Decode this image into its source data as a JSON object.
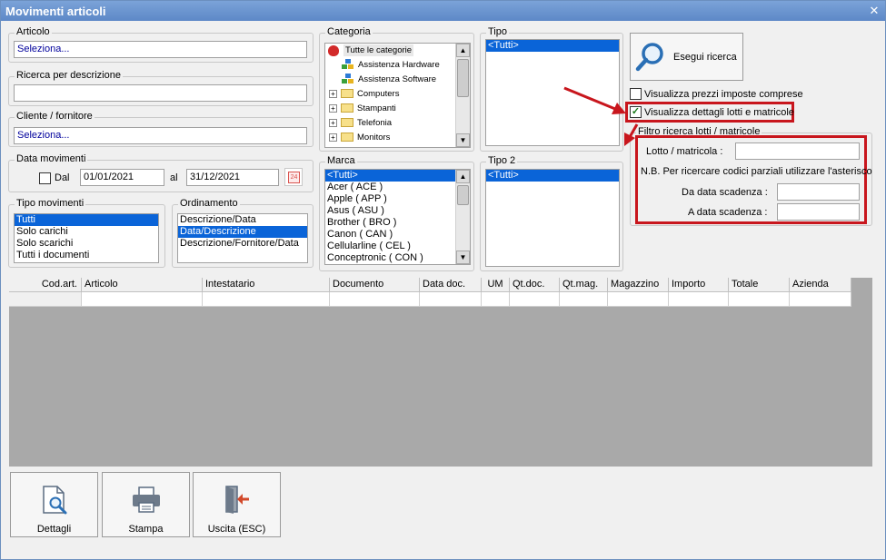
{
  "window": {
    "title": "Movimenti articoli",
    "close_glyph": "✕"
  },
  "articolo": {
    "label": "Articolo",
    "value": "Seleziona..."
  },
  "ricerca": {
    "label": "Ricerca per descrizione",
    "value": ""
  },
  "cliente": {
    "label": "Cliente / fornitore",
    "value": "Seleziona..."
  },
  "data_movimenti": {
    "label": "Data movimenti",
    "dal_label": "Dal",
    "dal_value": "01/01/2021",
    "al_label": "al",
    "al_value": "31/12/2021",
    "calendar_day": "24"
  },
  "tipo_movimenti": {
    "label": "Tipo movimenti",
    "items": [
      "Tutti",
      "Solo carichi",
      "Solo scarichi",
      "Tutti i documenti"
    ],
    "selected": 0
  },
  "ordinamento": {
    "label": "Ordinamento",
    "items": [
      "Descrizione/Data",
      "Data/Descrizione",
      "Descrizione/Fornitore/Data"
    ],
    "selected": 1
  },
  "categoria": {
    "label": "Categoria",
    "root": "Tutte le categorie",
    "children": [
      {
        "label": "Assistenza Hardware",
        "icon": "network-icon",
        "expandable": false
      },
      {
        "label": "Assistenza Software",
        "icon": "network-icon",
        "expandable": false
      },
      {
        "label": "Computers",
        "icon": "folder-icon",
        "expandable": true
      },
      {
        "label": "Stampanti",
        "icon": "folder-icon",
        "expandable": true
      },
      {
        "label": "Telefonia",
        "icon": "folder-icon",
        "expandable": true
      },
      {
        "label": "Monitors",
        "icon": "folder-icon",
        "expandable": true
      }
    ]
  },
  "marca": {
    "label": "Marca",
    "items": [
      "<Tutti>",
      "Acer ( ACE )",
      "Apple ( APP )",
      "Asus ( ASU )",
      "Brother ( BRO )",
      "Canon ( CAN )",
      "Cellularline ( CEL )",
      "Conceptronic ( CON )"
    ],
    "selected": 0
  },
  "tipo": {
    "label": "Tipo",
    "items": [
      "<Tutti>"
    ],
    "selected": 0
  },
  "tipo2": {
    "label": "Tipo 2",
    "items": [
      "<Tutti>"
    ],
    "selected": 0
  },
  "esegui": {
    "label": "Esegui ricerca"
  },
  "options": {
    "prezzi_label": "Visualizza prezzi imposte comprese",
    "prezzi_checked": false,
    "lotti_label": "Visualizza dettagli lotti e matricole",
    "lotti_checked": true,
    "check_glyph": "✓"
  },
  "filtro": {
    "label": "Filtro ricerca lotti / matricole",
    "lotto_label": "Lotto / matricola :",
    "lotto_value": "",
    "note": "N.B. Per ricercare codici parziali utilizzare l'asterisco",
    "da_label": "Da data scadenza :",
    "da_value": "",
    "a_label": "A data scadenza :",
    "a_value": ""
  },
  "grid": {
    "columns": [
      "Cod.art.",
      "Articolo",
      "Intestatario",
      "Documento",
      "Data doc.",
      "UM",
      "Qt.doc.",
      "Qt.mag.",
      "Magazzino",
      "Importo",
      "Totale",
      "Azienda"
    ]
  },
  "buttons": {
    "dettagli": "Dettagli",
    "stampa": "Stampa",
    "uscita": "Uscita (ESC)"
  },
  "colors": {
    "accent": "#0a64d8",
    "annotation": "#c8161d",
    "titlebar": "#5d88c7"
  }
}
